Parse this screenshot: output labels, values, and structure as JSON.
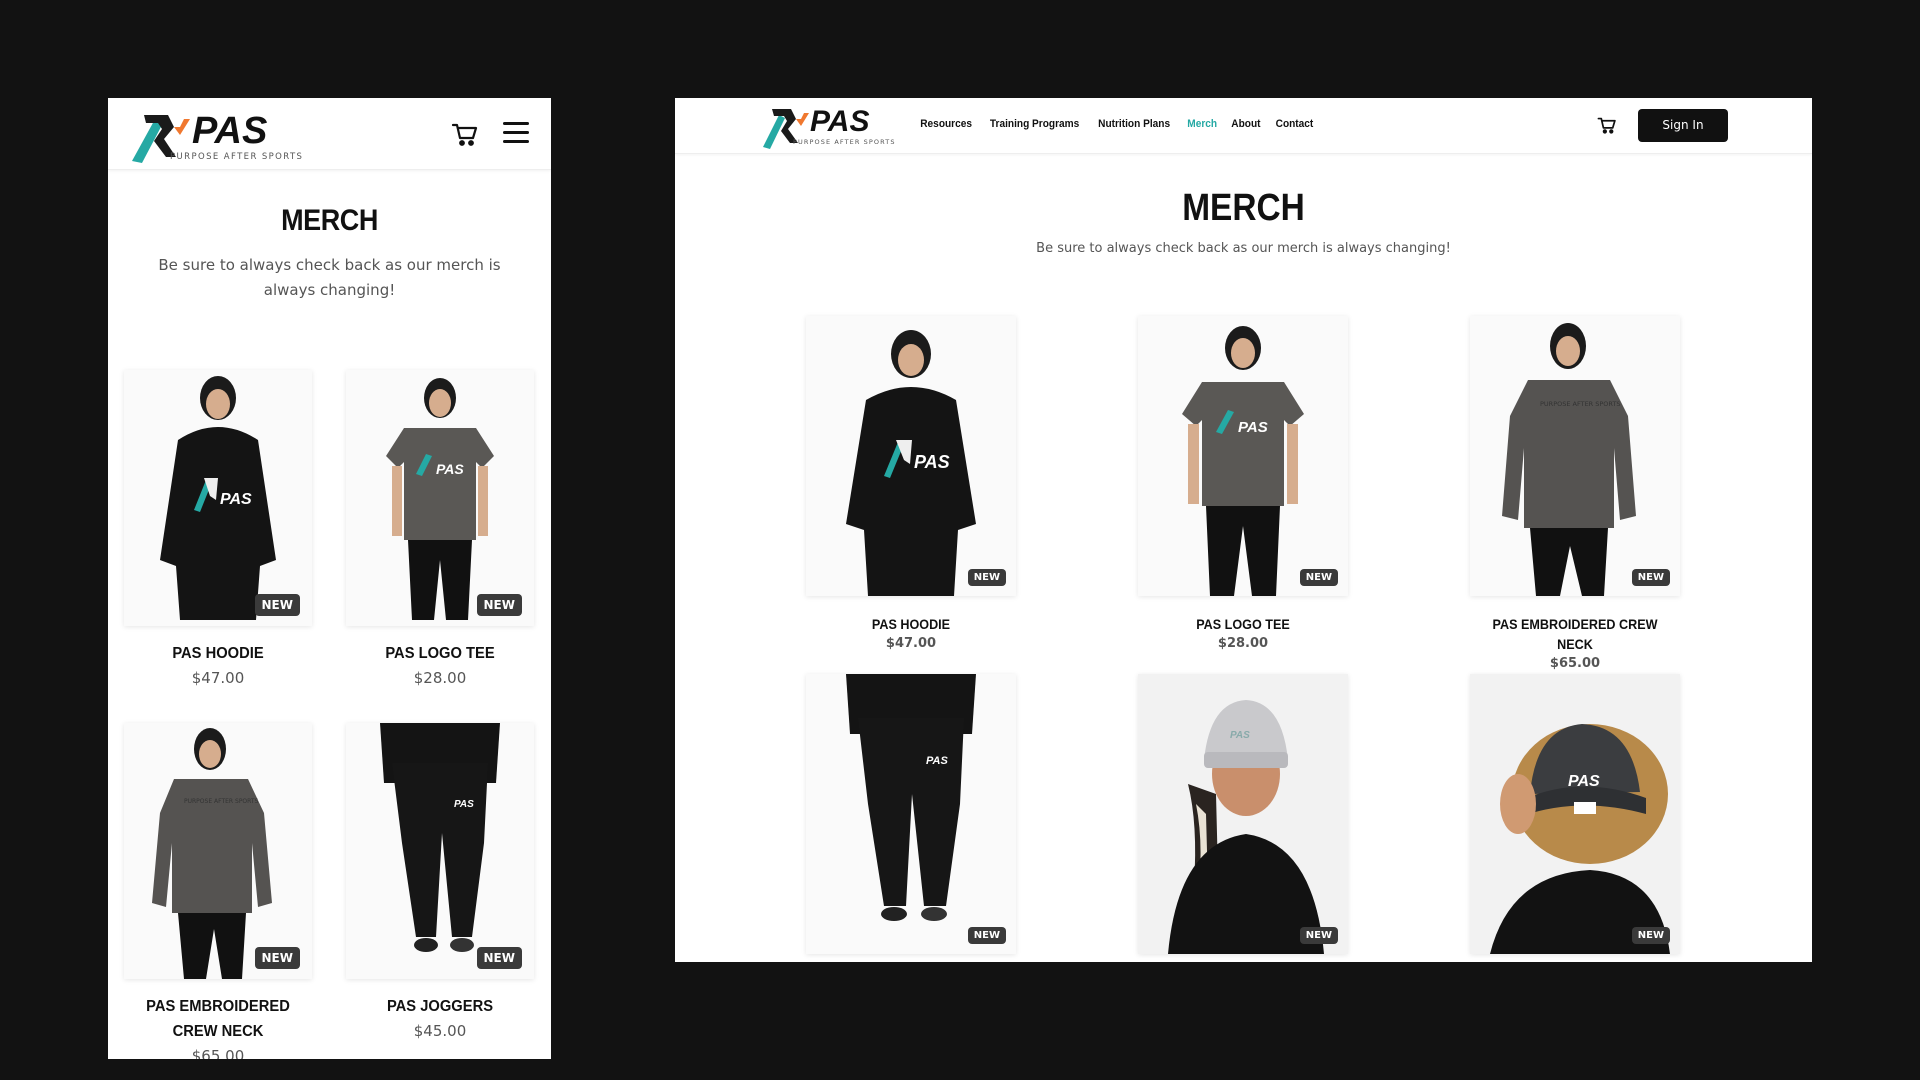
{
  "brand": {
    "logo_text": "PAS",
    "tagline": "PURPOSE AFTER SPORTS",
    "colors": {
      "teal": "#25a9a4",
      "orange": "#f0782f",
      "dark": "#1a1a1a"
    }
  },
  "nav": {
    "items": [
      "Resources",
      "Training Programs",
      "Nutrition Plans",
      "Merch",
      "About",
      "Contact"
    ],
    "active": "Merch",
    "sign_in_label": "Sign In",
    "cart_icon": "cart-icon",
    "menu_icon": "hamburger-menu-icon"
  },
  "page": {
    "title": "MERCH",
    "subtitle": "Be sure to always check back as our merch is always changing!"
  },
  "badge_label": "NEW",
  "products": [
    {
      "name": "PAS HOODIE",
      "price": "$47.00",
      "badge": "NEW",
      "image": "hoodie"
    },
    {
      "name": "PAS LOGO TEE",
      "price": "$28.00",
      "badge": "NEW",
      "image": "tee"
    },
    {
      "name": "PAS EMBROIDERED CREW NECK",
      "price": "$65.00",
      "badge": "NEW",
      "image": "crewneck"
    },
    {
      "name": "PAS JOGGERS",
      "price": "$45.00",
      "badge": "NEW",
      "image": "joggers"
    },
    {
      "name": "",
      "price": "",
      "badge": "NEW",
      "image": "beanie"
    },
    {
      "name": "",
      "price": "",
      "badge": "NEW",
      "image": "cap"
    }
  ]
}
